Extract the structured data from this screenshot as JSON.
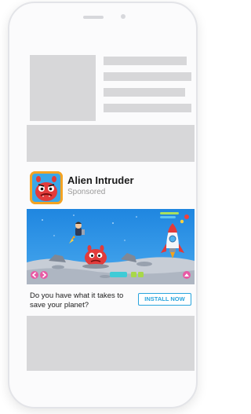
{
  "ad": {
    "app_name": "Alien Intruder",
    "sponsored_label": "Sponsored",
    "description": "Do you have what it takes to save your planet?",
    "cta_label": "INSTALL NOW"
  },
  "colors": {
    "cta_accent": "#29a4dd",
    "placeholder": "#d7d7d9",
    "sky": "#2a8fe3",
    "icon_background": "#f4a323"
  },
  "icons": {
    "app_icon": "red-alien-monster-icon",
    "prev_arrow": "chevron-left-icon",
    "next_arrow": "chevron-right-icon"
  }
}
